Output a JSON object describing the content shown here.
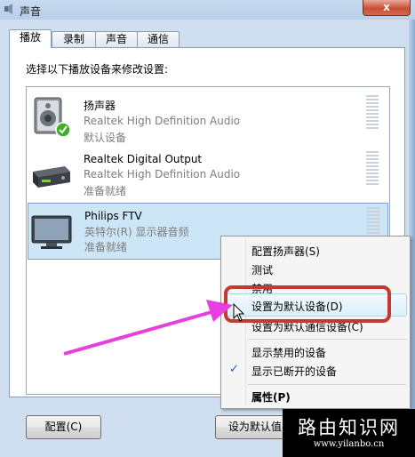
{
  "window": {
    "title": "声音",
    "close_label": "x"
  },
  "tabs": [
    {
      "label": "播放"
    },
    {
      "label": "录制"
    },
    {
      "label": "声音"
    },
    {
      "label": "通信"
    }
  ],
  "instruction": "选择以下播放设备来修改设置:",
  "devices": [
    {
      "name": "扬声器",
      "driver": "Realtek High Definition Audio",
      "status": "默认设备",
      "icon": "speaker-icon"
    },
    {
      "name": "Realtek Digital Output",
      "driver": "Realtek High Definition Audio",
      "status": "准备就绪",
      "icon": "digital-output-icon"
    },
    {
      "name": "Philips FTV",
      "driver": "英特尔(R) 显示器音频",
      "status": "准备就绪",
      "icon": "monitor-icon"
    }
  ],
  "context_menu": {
    "items": [
      {
        "label": "配置扬声器(S)"
      },
      {
        "label": "测试"
      },
      {
        "label": "禁用"
      },
      {
        "label": "设置为默认设备(D)"
      },
      {
        "label": "设置为默认通信设备(C)"
      },
      {
        "label": "显示禁用的设备"
      },
      {
        "label": "显示已断开的设备"
      },
      {
        "label": "属性(P)"
      }
    ],
    "checked_mark": "✓"
  },
  "buttons": {
    "configure": "配置(C)",
    "set_default": "设为默认值(S"
  },
  "watermark": {
    "title": "路由知识网",
    "url": "www.yilanbo.cn"
  },
  "colors": {
    "highlight_box": "#c33b2e",
    "arrow": "#e83ee0",
    "selection": "#cde6f7"
  }
}
